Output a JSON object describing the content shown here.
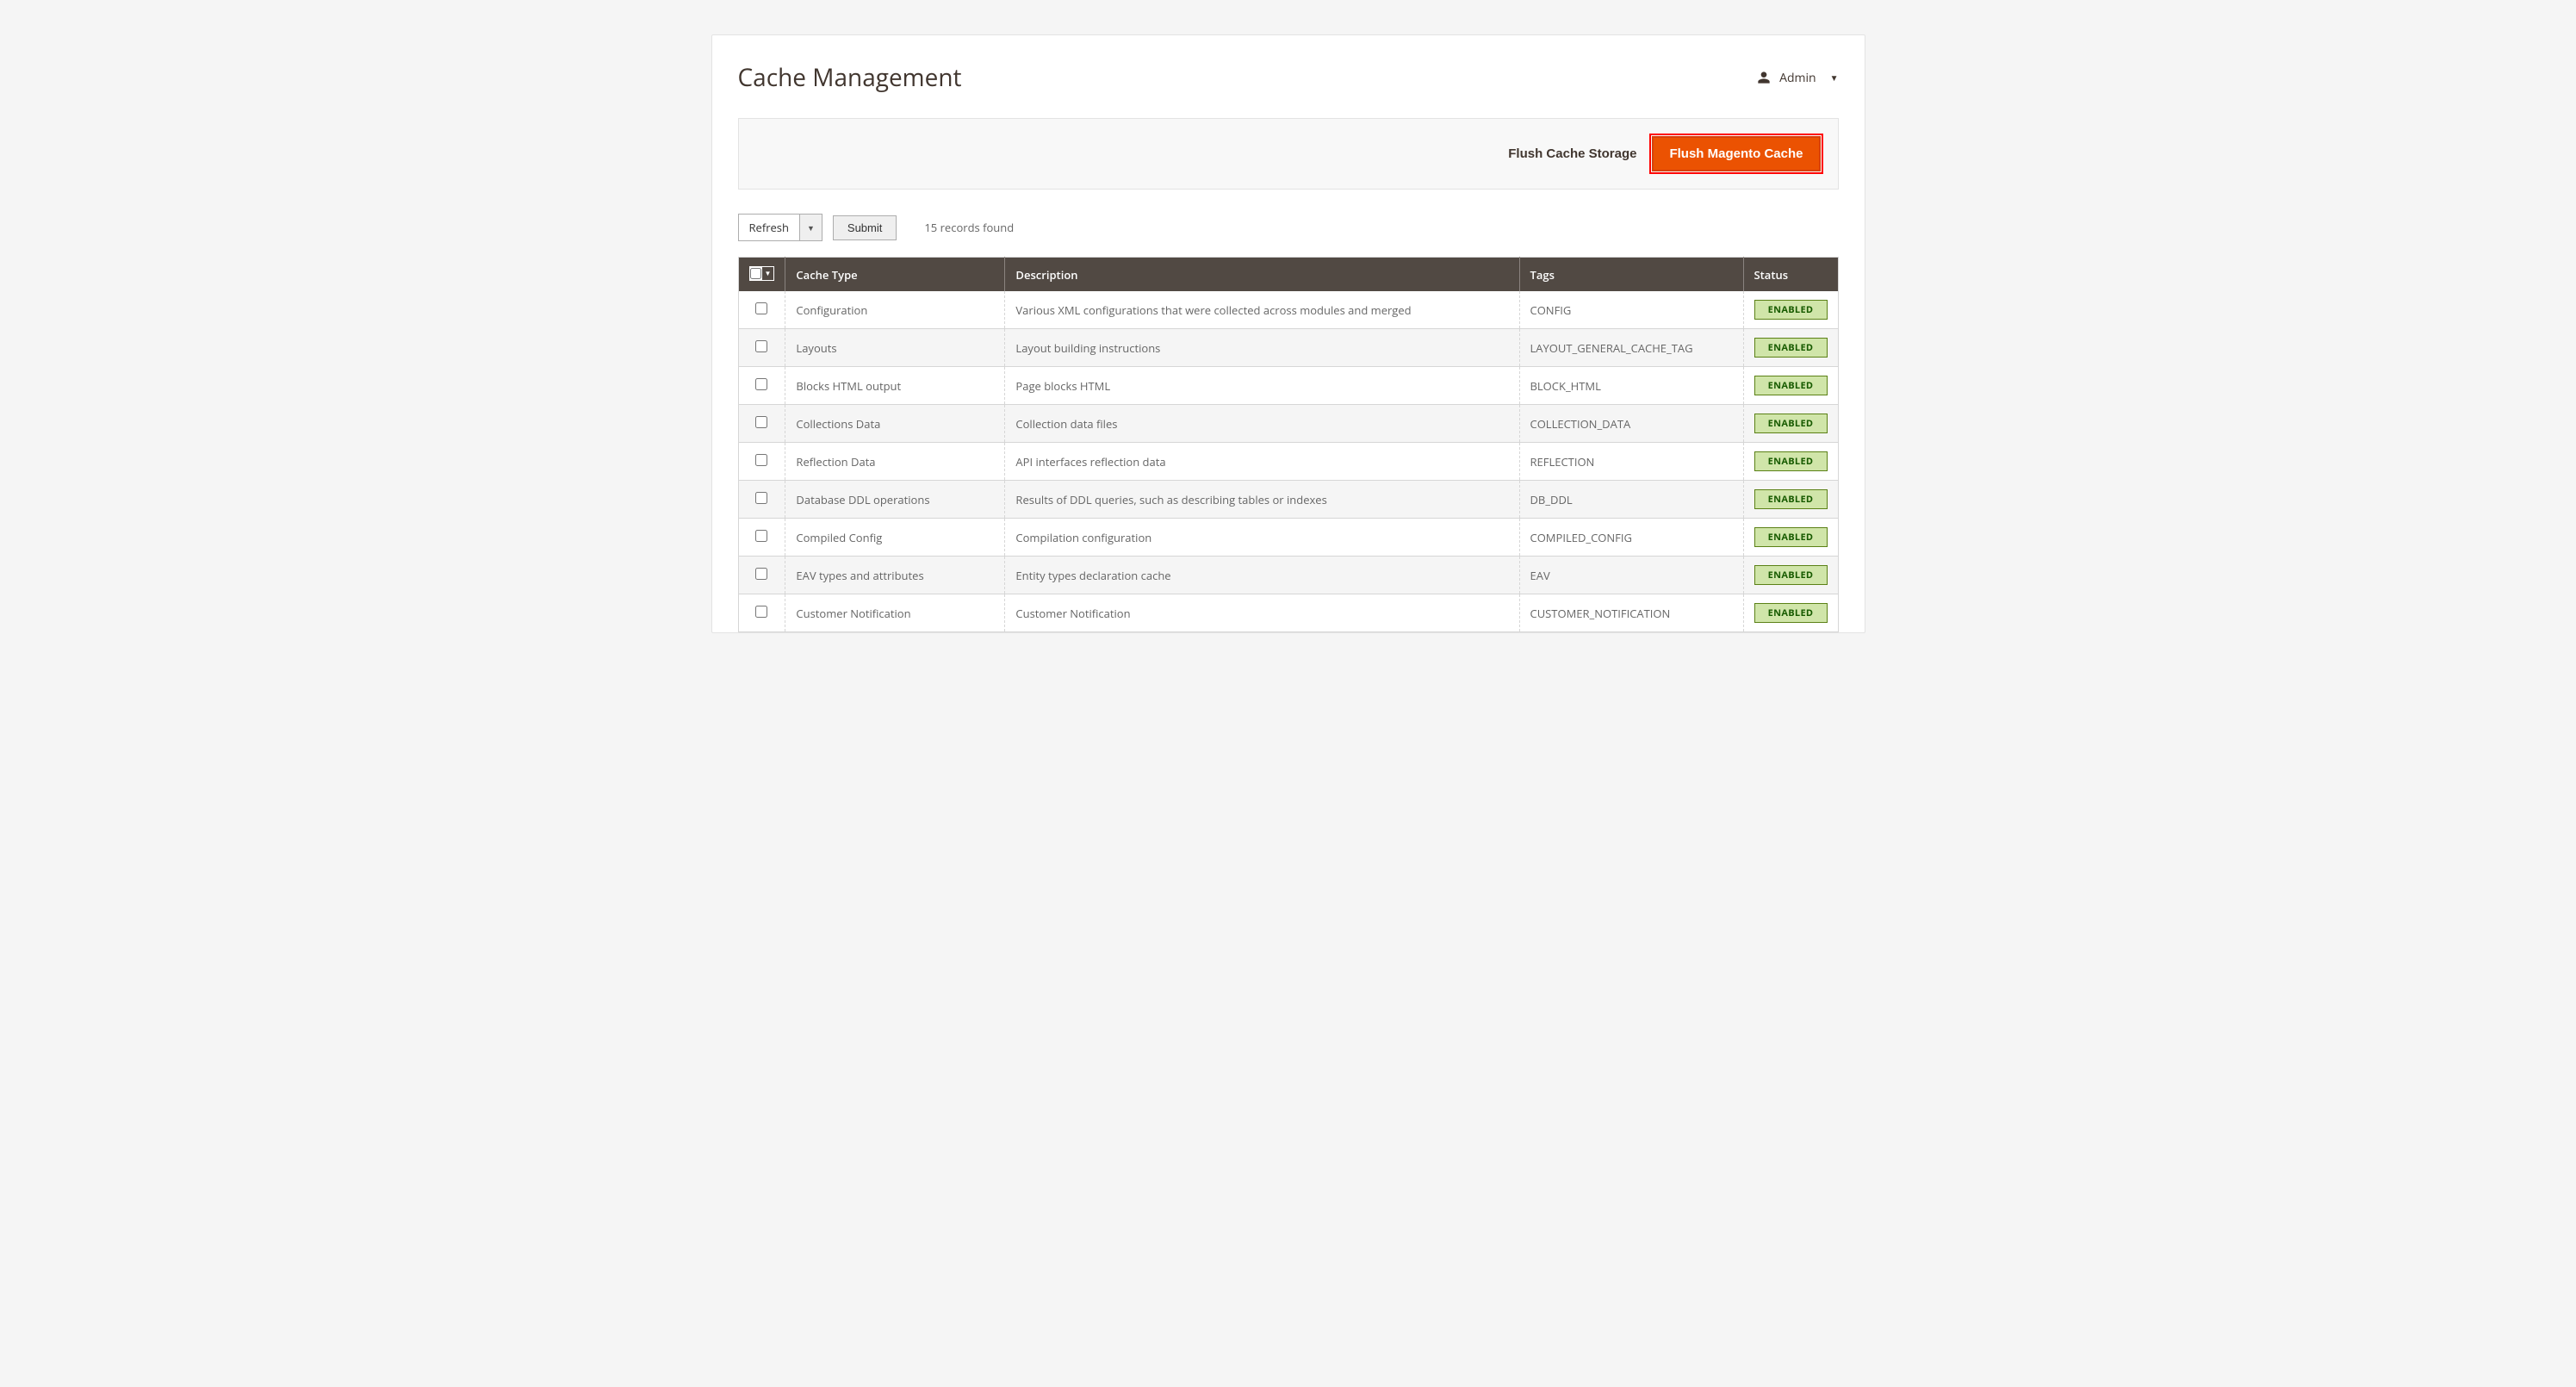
{
  "header": {
    "title": "Cache Management",
    "user_label": "Admin"
  },
  "actions": {
    "flush_storage": "Flush Cache Storage",
    "flush_magento": "Flush Magento Cache"
  },
  "controls": {
    "mass_action": "Refresh",
    "submit": "Submit",
    "records_found": "15 records found"
  },
  "columns": {
    "cache_type": "Cache Type",
    "description": "Description",
    "tags": "Tags",
    "status": "Status"
  },
  "status_labels": {
    "enabled": "ENABLED"
  },
  "rows": [
    {
      "type": "Configuration",
      "description": "Various XML configurations that were collected across modules and merged",
      "tags": "CONFIG",
      "status": "ENABLED"
    },
    {
      "type": "Layouts",
      "description": "Layout building instructions",
      "tags": "LAYOUT_GENERAL_CACHE_TAG",
      "status": "ENABLED"
    },
    {
      "type": "Blocks HTML output",
      "description": "Page blocks HTML",
      "tags": "BLOCK_HTML",
      "status": "ENABLED"
    },
    {
      "type": "Collections Data",
      "description": "Collection data files",
      "tags": "COLLECTION_DATA",
      "status": "ENABLED"
    },
    {
      "type": "Reflection Data",
      "description": "API interfaces reflection data",
      "tags": "REFLECTION",
      "status": "ENABLED"
    },
    {
      "type": "Database DDL operations",
      "description": "Results of DDL queries, such as describing tables or indexes",
      "tags": "DB_DDL",
      "status": "ENABLED"
    },
    {
      "type": "Compiled Config",
      "description": "Compilation configuration",
      "tags": "COMPILED_CONFIG",
      "status": "ENABLED"
    },
    {
      "type": "EAV types and attributes",
      "description": "Entity types declaration cache",
      "tags": "EAV",
      "status": "ENABLED"
    },
    {
      "type": "Customer Notification",
      "description": "Customer Notification",
      "tags": "CUSTOMER_NOTIFICATION",
      "status": "ENABLED"
    }
  ]
}
